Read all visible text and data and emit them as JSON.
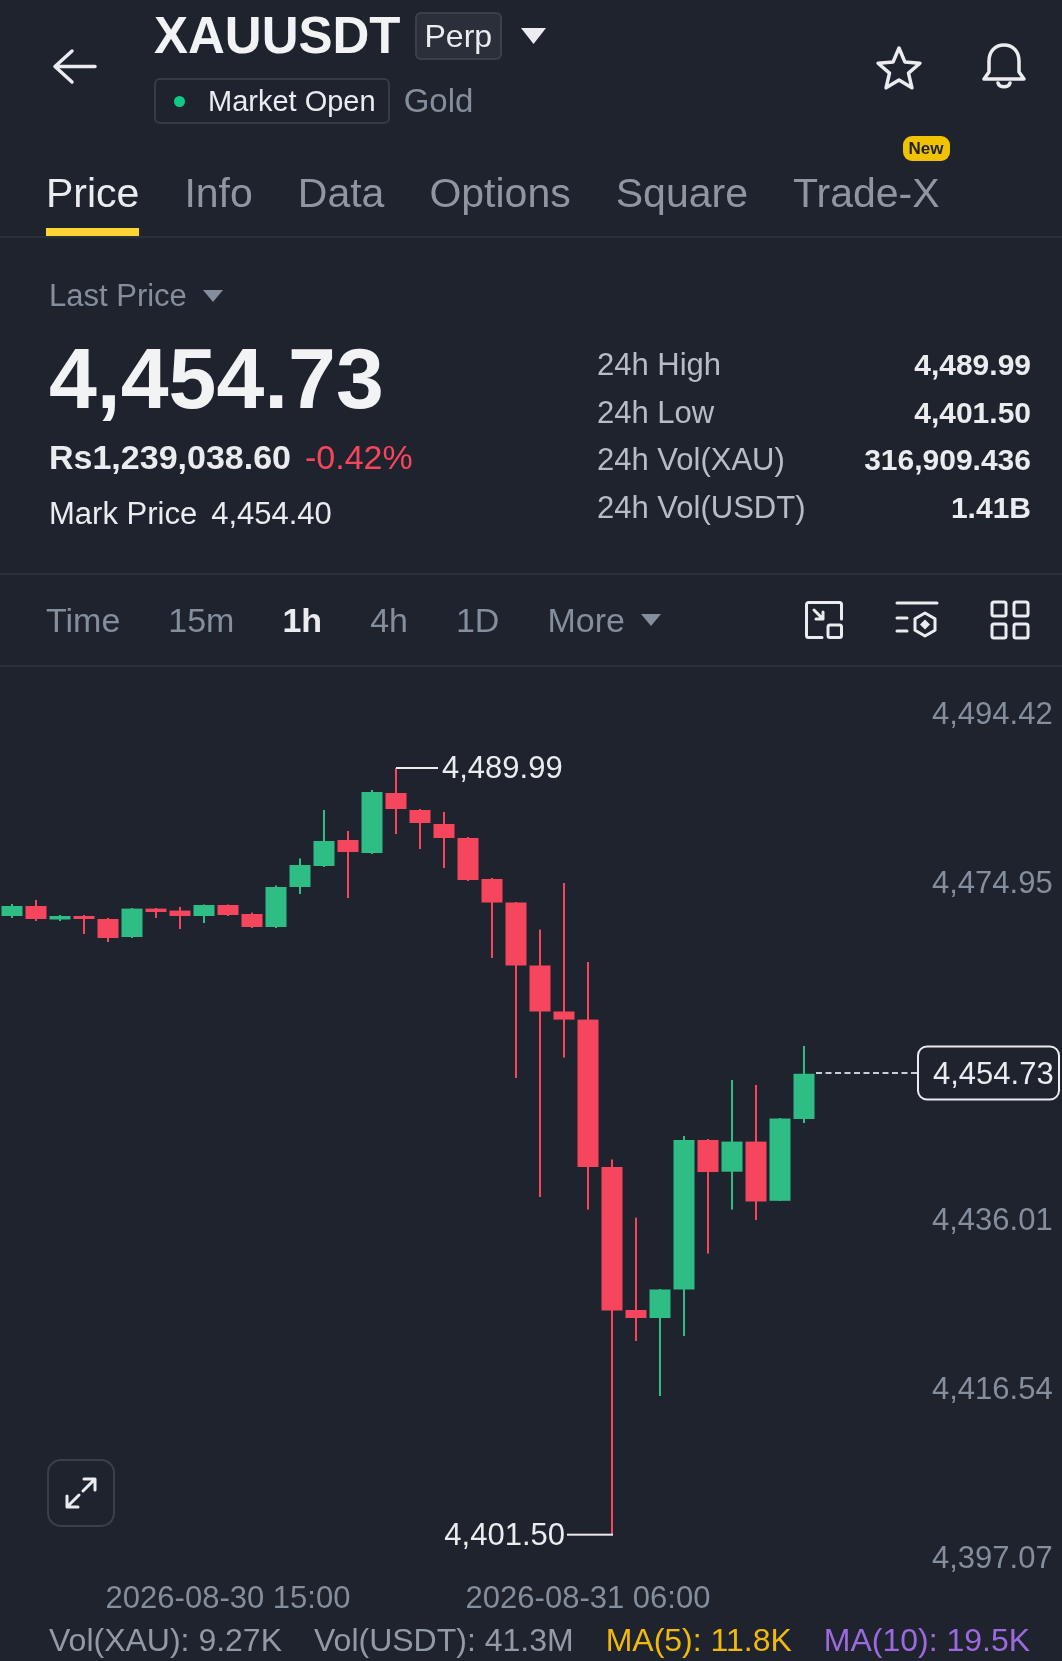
{
  "header": {
    "symbol": "XAUUSDT",
    "contract_badge": "Perp",
    "market_status": {
      "label": "Market Open",
      "open": true
    },
    "asset_name": "Gold"
  },
  "tabs": [
    {
      "label": "Price",
      "selected": true
    },
    {
      "label": "Info",
      "selected": false
    },
    {
      "label": "Data",
      "selected": false
    },
    {
      "label": "Options",
      "selected": false
    },
    {
      "label": "Square",
      "selected": false
    },
    {
      "label": "Trade-X",
      "selected": false,
      "badge": "New"
    }
  ],
  "price_summary": {
    "selector": "Last Price",
    "last_price": "4,454.73",
    "fiat_price": "Rs1,239,038.60",
    "change": "-0.42%",
    "change_negative": true,
    "mark_price_label": "Mark Price",
    "mark_price": "4,454.40",
    "stats": [
      {
        "label": "24h High",
        "value": "4,489.99"
      },
      {
        "label": "24h Low",
        "value": "4,401.50"
      },
      {
        "label": "24h Vol(XAU)",
        "value": "316,909.436"
      },
      {
        "label": "24h Vol(USDT)",
        "value": "1.41B"
      }
    ]
  },
  "intervals": [
    {
      "label": "Time",
      "selected": false,
      "kind": "option"
    },
    {
      "label": "15m",
      "selected": false,
      "kind": "option"
    },
    {
      "label": "1h",
      "selected": true,
      "kind": "option"
    },
    {
      "label": "4h",
      "selected": false,
      "kind": "option"
    },
    {
      "label": "1D",
      "selected": false,
      "kind": "option"
    },
    {
      "label": "More",
      "selected": false,
      "kind": "menu"
    }
  ],
  "chart": {
    "price_axis": [
      "4,494.42",
      "4,474.95",
      "4,436.01",
      "4,416.54",
      "4,397.07"
    ],
    "high_label": "4,489.99",
    "low_label": "4,401.50",
    "current_price": "4,454.73",
    "time_axis": [
      "2026-08-30 15:00",
      "2026-08-31 06:00"
    ]
  },
  "volume_legend": [
    {
      "text": "Vol(XAU): 9.27K",
      "color": "#929aa5"
    },
    {
      "text": "Vol(USDT): 41.3M",
      "color": "#929aa5"
    },
    {
      "text": "MA(5): 11.8K",
      "color": "#f0b90b"
    },
    {
      "text": "MA(10): 19.5K",
      "color": "#9c6ade"
    }
  ]
}
